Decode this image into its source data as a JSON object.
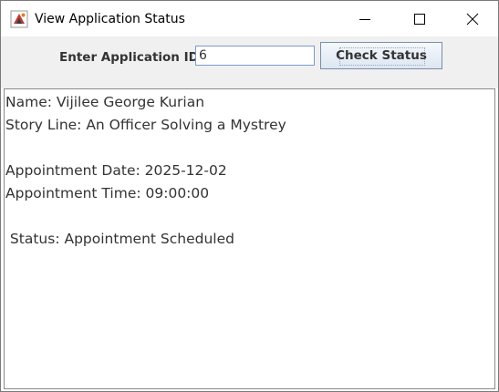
{
  "window": {
    "title": "View Application Status",
    "icon": "java-app-icon",
    "controls": {
      "minimize_icon": "minimize-icon",
      "maximize_icon": "maximize-icon",
      "close_icon": "close-icon"
    }
  },
  "form": {
    "id_label": "Enter Application ID:",
    "id_value": "6",
    "check_button_label": "Check Status"
  },
  "result": {
    "lines": [
      "Name: Vijilee George Kurian",
      "Story Line: An Officer Solving a Mystrey",
      "",
      "Appointment Date: 2025-12-02",
      "Appointment Time: 09:00:00",
      "",
      " Status: Appointment Scheduled"
    ]
  },
  "colors": {
    "panel_background": "#f0f0f0",
    "text": "#333333",
    "input_border": "#7a9ccc",
    "button_border": "#7a8ea8"
  }
}
